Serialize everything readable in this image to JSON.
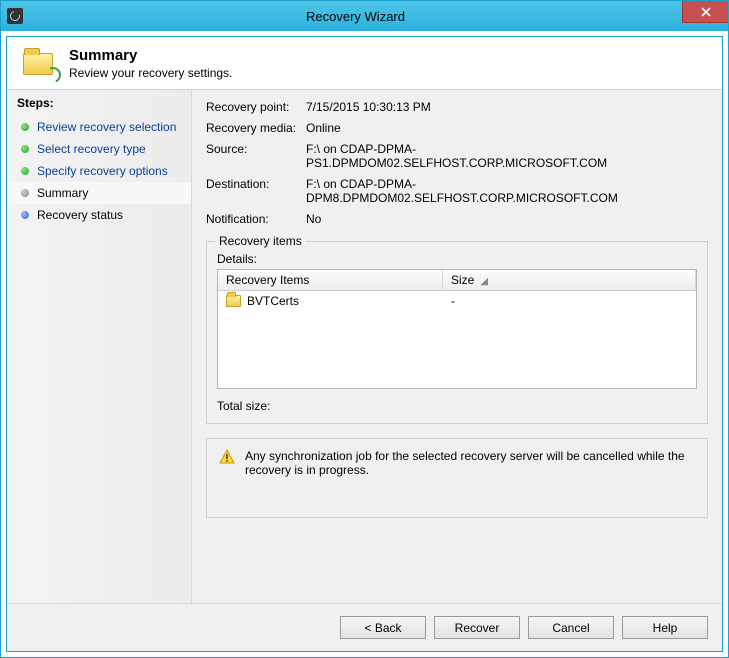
{
  "window": {
    "title": "Recovery Wizard"
  },
  "header": {
    "title": "Summary",
    "subtitle": "Review your recovery settings."
  },
  "sidebar": {
    "title": "Steps:",
    "items": [
      {
        "label": "Review recovery selection",
        "state": "done"
      },
      {
        "label": "Select recovery type",
        "state": "done"
      },
      {
        "label": "Specify recovery options",
        "state": "done"
      },
      {
        "label": "Summary",
        "state": "current"
      },
      {
        "label": "Recovery status",
        "state": "future"
      }
    ]
  },
  "summary": {
    "recovery_point_label": "Recovery point:",
    "recovery_point": "7/15/2015 10:30:13 PM",
    "recovery_media_label": "Recovery media:",
    "recovery_media": "Online",
    "source_label": "Source:",
    "source": "F:\\ on CDAP-DPMA-PS1.DPMDOM02.SELFHOST.CORP.MICROSOFT.COM",
    "destination_label": "Destination:",
    "destination": "F:\\ on CDAP-DPMA-DPM8.DPMDOM02.SELFHOST.CORP.MICROSOFT.COM",
    "notification_label": "Notification:",
    "notification": "No"
  },
  "recovery_items": {
    "group_title": "Recovery items",
    "details_label": "Details:",
    "columns": {
      "c1": "Recovery Items",
      "c2": "Size"
    },
    "rows": [
      {
        "name": "BVTCerts",
        "size": "-"
      }
    ],
    "total_label": "Total size:",
    "total_value": ""
  },
  "warning": {
    "text": "Any synchronization job for the selected recovery server will be cancelled while the recovery is in progress."
  },
  "buttons": {
    "back": "< Back",
    "recover": "Recover",
    "cancel": "Cancel",
    "help": "Help"
  }
}
